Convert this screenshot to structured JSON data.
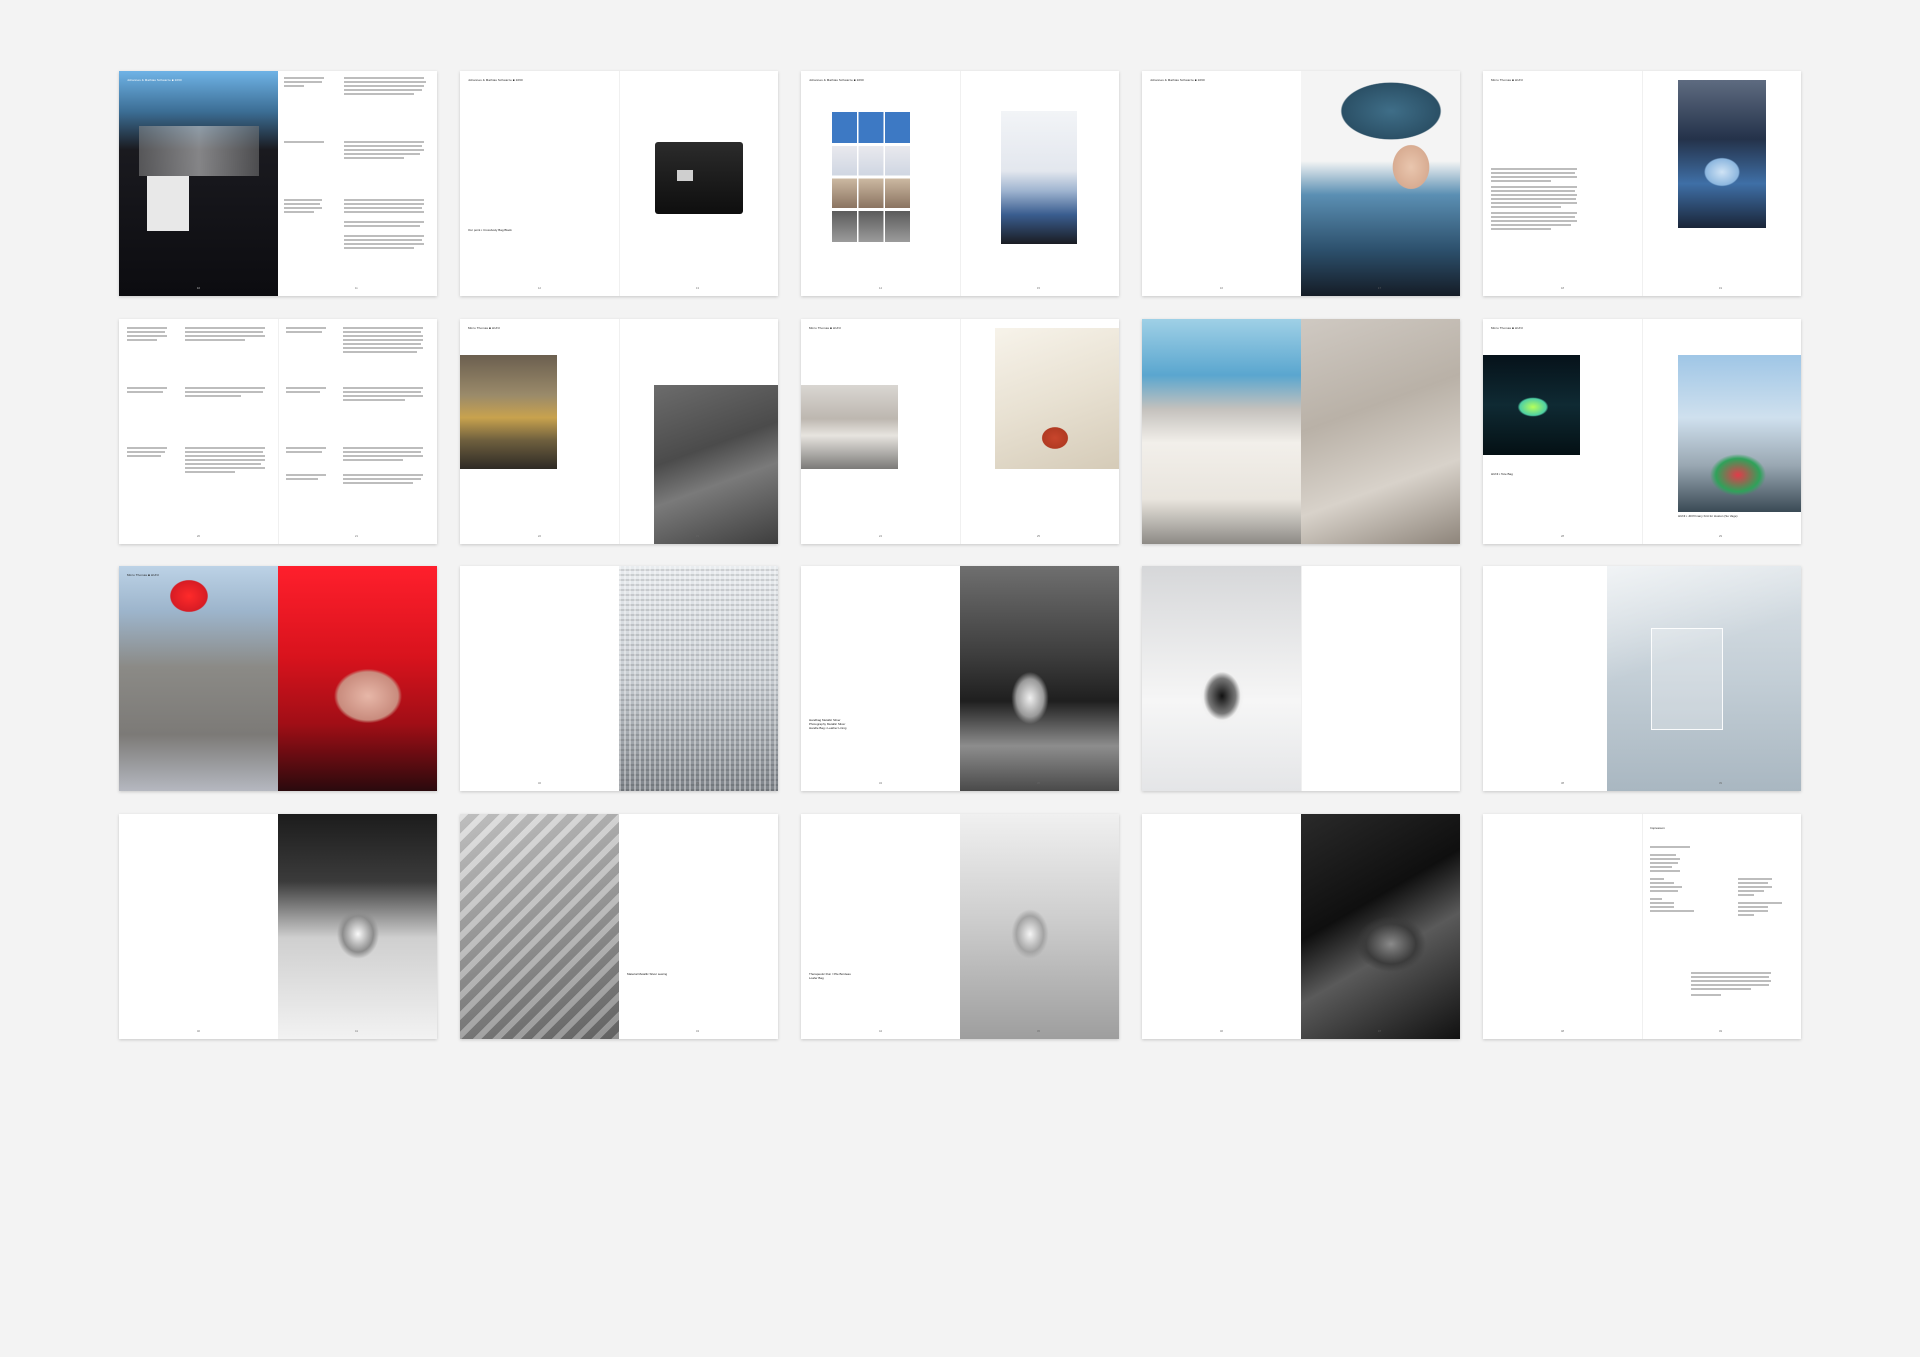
{
  "running_heads": {
    "schwarz": "Johannes & Mathias Schwarze ■ 1060",
    "thomas": "Mirco Thomas ■ HUNI"
  },
  "captions": {
    "bag_block": "Our point ▪ Crossbody Bag Black",
    "tote": "HUNI ▪ Tote Bag",
    "jacket": "HUNI ▪ Jill Primary Knit for Huston (So Vage)",
    "handle_bag": "Handbag Metallic Silver\nPhotography Metallic Silver\nHandle Bag ▪ Leather Lining",
    "material": "Material Metallic Silver sewing",
    "pouch": "Therapeutic Run / Pile Bordeau\nLoafer Bag"
  },
  "folios": {
    "s1": [
      "10",
      "11"
    ],
    "s2": [
      "12",
      "13"
    ],
    "s3": [
      "14",
      "15"
    ],
    "s4": [
      "16",
      "17"
    ],
    "s5": [
      "18",
      "19"
    ],
    "s6": [
      "20",
      "21"
    ],
    "s7": [
      "22",
      "23"
    ],
    "s8": [
      "24",
      "25"
    ],
    "s10": [
      "28",
      "29"
    ],
    "s12": [
      "32",
      "33"
    ],
    "s13": [
      "34",
      "35"
    ],
    "s15": [
      "38",
      "39"
    ],
    "s16": [
      "40",
      "41"
    ],
    "s17": [
      "42",
      "43"
    ],
    "s18": [
      "44",
      "45"
    ],
    "s19": [
      "46",
      "47"
    ],
    "s20": [
      "48",
      "49"
    ]
  },
  "imprint": {
    "title": "Impressum"
  },
  "colors": {
    "background": "#f3f3f3",
    "page": "#ffffff",
    "accent_red": "#e0232e",
    "accent_blue": "#2f6db3"
  }
}
